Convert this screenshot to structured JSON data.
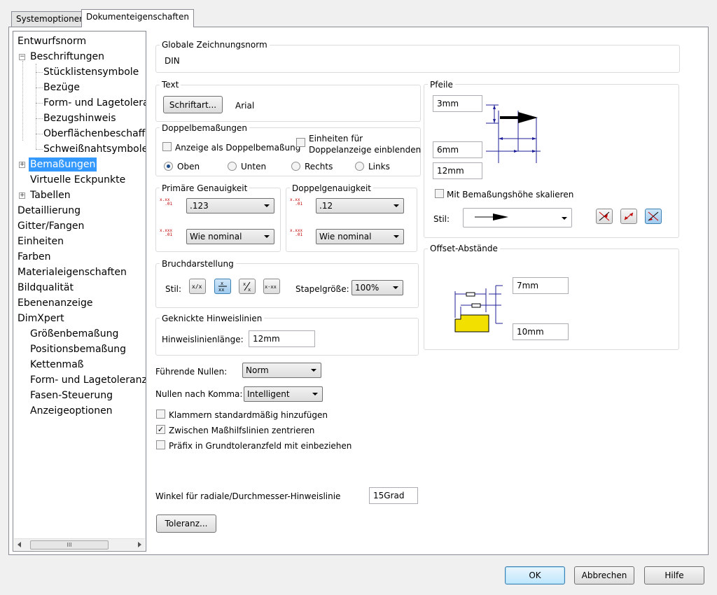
{
  "tabs": [
    "Systemoptionen",
    "Dokumenteigenschaften"
  ],
  "tree": {
    "items": [
      {
        "label": "Entwurfsnorm"
      },
      {
        "label": "Beschriftungen"
      },
      {
        "label": "Stücklistensymbole"
      },
      {
        "label": "Bezüge"
      },
      {
        "label": "Form- und Lagetoleranz"
      },
      {
        "label": "Bezugshinweis"
      },
      {
        "label": "Oberflächenbeschaffenheit"
      },
      {
        "label": "Schweißnahtsymbole"
      },
      {
        "label": "Bemaßungen"
      },
      {
        "label": "Virtuelle Eckpunkte"
      },
      {
        "label": "Tabellen"
      },
      {
        "label": "Detaillierung"
      },
      {
        "label": "Gitter/Fangen"
      },
      {
        "label": "Einheiten"
      },
      {
        "label": "Farben"
      },
      {
        "label": "Materialeigenschaften"
      },
      {
        "label": "Bildqualität"
      },
      {
        "label": "Ebenenanzeige"
      },
      {
        "label": "DimXpert"
      },
      {
        "label": "Größenbemaßung"
      },
      {
        "label": "Positionsbemaßung"
      },
      {
        "label": "Kettenmaß"
      },
      {
        "label": "Form- und Lagetoleranz"
      },
      {
        "label": "Fasen-Steuerung"
      },
      {
        "label": "Anzeigeoptionen"
      }
    ],
    "selected": "Bemaßungen",
    "scroll_grip": "III"
  },
  "global_norm": {
    "title": "Globale Zeichnungsnorm",
    "value": "DIN"
  },
  "text": {
    "title": "Text",
    "font_button": "Schriftart...",
    "font_value": "Arial"
  },
  "dual": {
    "title": "Doppelbemaßungen",
    "show_dual": "Anzeige als Doppelbemaßung",
    "show_units_line1": "Einheiten für",
    "show_units_line2": "Doppelanzeige einblenden",
    "radios": [
      "Oben",
      "Unten",
      "Rechts",
      "Links"
    ],
    "selected": "Oben"
  },
  "primary_precision": {
    "title": "Primäre Genauigkeit",
    "value": ".123",
    "tolerance": "Wie nominal"
  },
  "dual_precision": {
    "title": "Doppelgenauigkeit",
    "value": ".12",
    "tolerance": "Wie nominal"
  },
  "break": {
    "title": "Bruchdarstellung",
    "style_label": "Stil:",
    "stack_label": "Stapelgröße:",
    "stack_value": "100%"
  },
  "bent_leaders": {
    "title": "Geknickte Hinweislinien",
    "length_label": "Hinweislinienlänge:",
    "length_value": "12mm"
  },
  "leading_zeros": {
    "label": "Führende Nullen:",
    "value": "Norm"
  },
  "trailing_zeros": {
    "label": "Nullen nach Komma:",
    "value": "Intelligent"
  },
  "checkboxes": [
    {
      "label": "Klammern standardmäßig hinzufügen",
      "checked": false
    },
    {
      "label": "Zwischen Maßhilfslinien zentrieren",
      "checked": true
    },
    {
      "label": "Präfix in Grundtoleranzfeld mit einbeziehen",
      "checked": false
    }
  ],
  "radial_angle": {
    "label": "Winkel für radiale/Durchmesser-Hinweislinie",
    "value": "15Grad"
  },
  "tolerance_button": "Toleranz...",
  "arrows": {
    "title": "Pfeile",
    "size1": "3mm",
    "size2": "6mm",
    "size3": "12mm",
    "scale_label": "Mit Bemaßungshöhe skalieren",
    "style_label": "Stil:"
  },
  "offset": {
    "title": "Offset-Abstände",
    "value1": "7mm",
    "value2": "10mm"
  },
  "footer": {
    "ok": "OK",
    "cancel": "Abbrechen",
    "help": "Hilfe"
  },
  "colors": {
    "selection": "#3399ff",
    "accent_red": "#c00000",
    "dim_blue": "#1f1f9a",
    "part_yellow": "#f2e100"
  }
}
